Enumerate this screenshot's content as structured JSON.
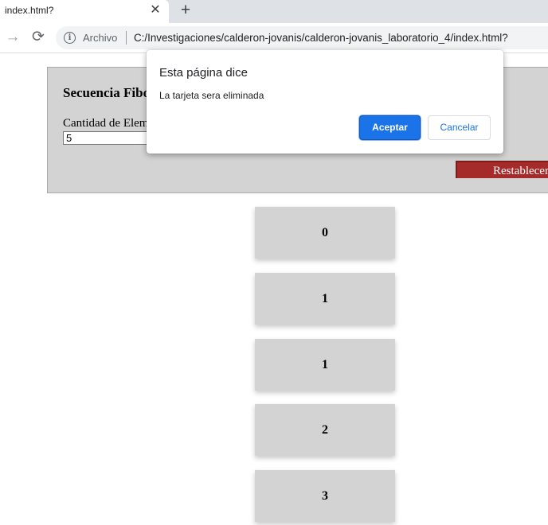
{
  "browser": {
    "tab_title": "index.html?",
    "tab_close": "✕",
    "new_tab": "+",
    "forward_glyph": "→",
    "reload_glyph": "⟳",
    "info_glyph": "i",
    "omnibox_label": "Archivo",
    "url": "C:/Investigaciones/calderon-jovanis/calderon-jovanis_laboratorio_4/index.html?"
  },
  "panel": {
    "title": "Secuencia Fibonacci",
    "quantity_label": "Cantidad de Elementos",
    "quantity_value": "5",
    "reset_label": "Restablecer"
  },
  "cards": [
    "0",
    "1",
    "1",
    "2",
    "3"
  ],
  "dialog": {
    "title": "Esta página dice",
    "message": "La tarjeta sera eliminada",
    "ok_label": "Aceptar",
    "cancel_label": "Cancelar"
  },
  "colors": {
    "panel_bg": "#d3d3d3",
    "reset_button": "#a52a2a",
    "accent": "#1a73e8"
  }
}
